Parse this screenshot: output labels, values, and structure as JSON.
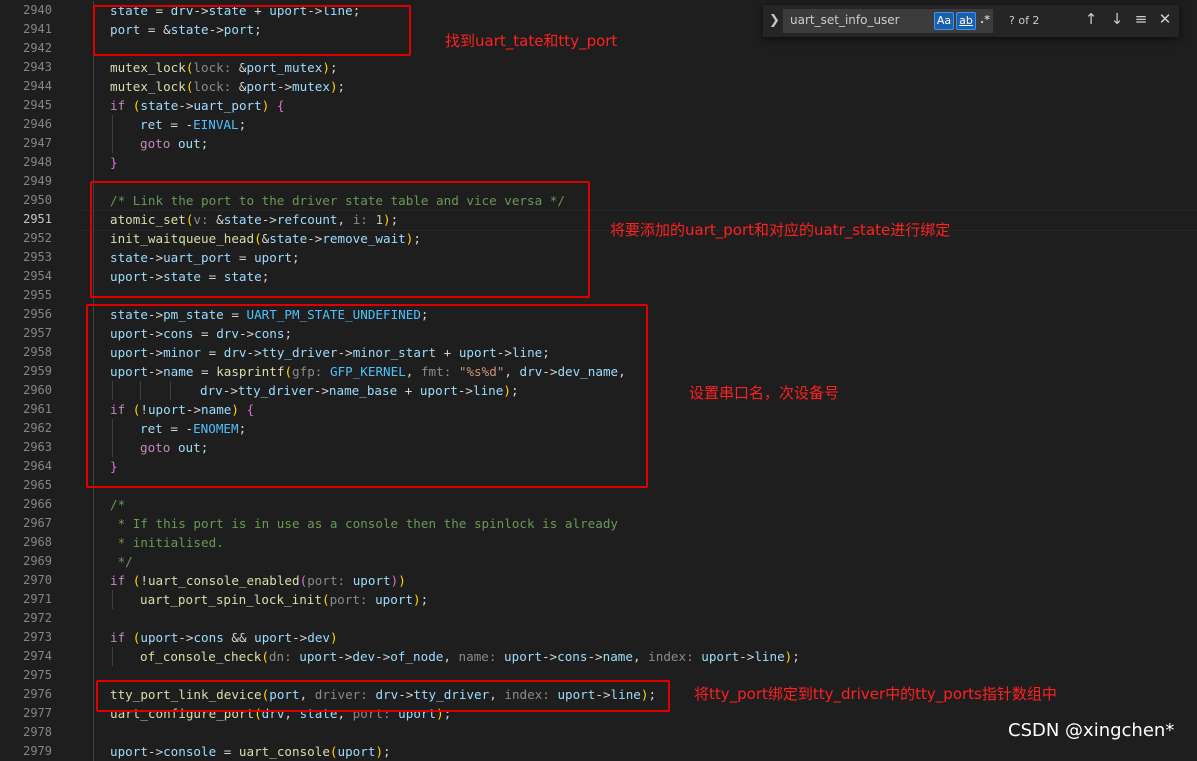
{
  "editor": {
    "current_line": "2951",
    "lines": [
      {
        "n": "2940",
        "ind": 1,
        "t": [
          [
            "var",
            "state"
          ],
          [
            "op",
            " = "
          ],
          [
            "var",
            "drv"
          ],
          [
            "op",
            "->"
          ],
          [
            "var",
            "state"
          ],
          [
            "op",
            " + "
          ],
          [
            "var",
            "uport"
          ],
          [
            "op",
            "->"
          ],
          [
            "var",
            "line"
          ],
          [
            "op",
            ";"
          ]
        ]
      },
      {
        "n": "2941",
        "ind": 1,
        "t": [
          [
            "var",
            "port"
          ],
          [
            "op",
            " = &"
          ],
          [
            "var",
            "state"
          ],
          [
            "op",
            "->"
          ],
          [
            "var",
            "port"
          ],
          [
            "op",
            ";"
          ]
        ]
      },
      {
        "n": "2942",
        "ind": 0,
        "t": []
      },
      {
        "n": "2943",
        "ind": 1,
        "t": [
          [
            "fn",
            "mutex_lock"
          ],
          [
            "br",
            "("
          ],
          [
            "hint",
            "lock: "
          ],
          [
            "op",
            "&"
          ],
          [
            "var",
            "port_mutex"
          ],
          [
            "br",
            ")"
          ],
          [
            "op",
            ";"
          ]
        ]
      },
      {
        "n": "2944",
        "ind": 1,
        "t": [
          [
            "fn",
            "mutex_lock"
          ],
          [
            "br",
            "("
          ],
          [
            "hint",
            "lock: "
          ],
          [
            "op",
            "&"
          ],
          [
            "var",
            "port"
          ],
          [
            "op",
            "->"
          ],
          [
            "var",
            "mutex"
          ],
          [
            "br",
            ")"
          ],
          [
            "op",
            ";"
          ]
        ]
      },
      {
        "n": "2945",
        "ind": 1,
        "t": [
          [
            "kw",
            "if"
          ],
          [
            "op",
            " "
          ],
          [
            "br",
            "("
          ],
          [
            "var",
            "state"
          ],
          [
            "op",
            "->"
          ],
          [
            "var",
            "uart_port"
          ],
          [
            "br",
            ")"
          ],
          [
            "op",
            " "
          ],
          [
            "br2",
            "{"
          ]
        ]
      },
      {
        "n": "2946",
        "ind": 2,
        "t": [
          [
            "var",
            "ret"
          ],
          [
            "op",
            " = -"
          ],
          [
            "const",
            "EINVAL"
          ],
          [
            "op",
            ";"
          ]
        ]
      },
      {
        "n": "2947",
        "ind": 2,
        "t": [
          [
            "kw",
            "goto"
          ],
          [
            "op",
            " "
          ],
          [
            "var",
            "out"
          ],
          [
            "op",
            ";"
          ]
        ]
      },
      {
        "n": "2948",
        "ind": 1,
        "t": [
          [
            "br2",
            "}"
          ]
        ]
      },
      {
        "n": "2949",
        "ind": 0,
        "t": []
      },
      {
        "n": "2950",
        "ind": 1,
        "t": [
          [
            "cmt",
            "/* Link the port to the driver state table and vice versa */"
          ]
        ]
      },
      {
        "n": "2951",
        "ind": 1,
        "t": [
          [
            "fn",
            "atomic_set"
          ],
          [
            "br",
            "("
          ],
          [
            "hint",
            "v: "
          ],
          [
            "op",
            "&"
          ],
          [
            "var",
            "state"
          ],
          [
            "op",
            "->"
          ],
          [
            "var",
            "refcount"
          ],
          [
            "op",
            ", "
          ],
          [
            "hint",
            "i: "
          ],
          [
            "num",
            "1"
          ],
          [
            "br",
            ")"
          ],
          [
            "op",
            ";"
          ]
        ]
      },
      {
        "n": "2952",
        "ind": 1,
        "t": [
          [
            "fn",
            "init_waitqueue_head"
          ],
          [
            "br",
            "("
          ],
          [
            "op",
            "&"
          ],
          [
            "var",
            "state"
          ],
          [
            "op",
            "->"
          ],
          [
            "var",
            "remove_wait"
          ],
          [
            "br",
            ")"
          ],
          [
            "op",
            ";"
          ]
        ]
      },
      {
        "n": "2953",
        "ind": 1,
        "t": [
          [
            "var",
            "state"
          ],
          [
            "op",
            "->"
          ],
          [
            "var",
            "uart_port"
          ],
          [
            "op",
            " = "
          ],
          [
            "var",
            "uport"
          ],
          [
            "op",
            ";"
          ]
        ]
      },
      {
        "n": "2954",
        "ind": 1,
        "t": [
          [
            "var",
            "uport"
          ],
          [
            "op",
            "->"
          ],
          [
            "var",
            "state"
          ],
          [
            "op",
            " = "
          ],
          [
            "var",
            "state"
          ],
          [
            "op",
            ";"
          ]
        ]
      },
      {
        "n": "2955",
        "ind": 0,
        "t": []
      },
      {
        "n": "2956",
        "ind": 1,
        "t": [
          [
            "var",
            "state"
          ],
          [
            "op",
            "->"
          ],
          [
            "var",
            "pm_state"
          ],
          [
            "op",
            " = "
          ],
          [
            "const",
            "UART_PM_STATE_UNDEFINED"
          ],
          [
            "op",
            ";"
          ]
        ]
      },
      {
        "n": "2957",
        "ind": 1,
        "t": [
          [
            "var",
            "uport"
          ],
          [
            "op",
            "->"
          ],
          [
            "var",
            "cons"
          ],
          [
            "op",
            " = "
          ],
          [
            "var",
            "drv"
          ],
          [
            "op",
            "->"
          ],
          [
            "var",
            "cons"
          ],
          [
            "op",
            ";"
          ]
        ]
      },
      {
        "n": "2958",
        "ind": 1,
        "t": [
          [
            "var",
            "uport"
          ],
          [
            "op",
            "->"
          ],
          [
            "var",
            "minor"
          ],
          [
            "op",
            " = "
          ],
          [
            "var",
            "drv"
          ],
          [
            "op",
            "->"
          ],
          [
            "var",
            "tty_driver"
          ],
          [
            "op",
            "->"
          ],
          [
            "var",
            "minor_start"
          ],
          [
            "op",
            " + "
          ],
          [
            "var",
            "uport"
          ],
          [
            "op",
            "->"
          ],
          [
            "var",
            "line"
          ],
          [
            "op",
            ";"
          ]
        ]
      },
      {
        "n": "2959",
        "ind": 1,
        "t": [
          [
            "var",
            "uport"
          ],
          [
            "op",
            "->"
          ],
          [
            "var",
            "name"
          ],
          [
            "op",
            " = "
          ],
          [
            "fn",
            "kasprintf"
          ],
          [
            "br",
            "("
          ],
          [
            "hint",
            "gfp: "
          ],
          [
            "const",
            "GFP_KERNEL"
          ],
          [
            "op",
            ", "
          ],
          [
            "hint",
            "fmt: "
          ],
          [
            "str",
            "\"%s%d\""
          ],
          [
            "op",
            ", "
          ],
          [
            "var",
            "drv"
          ],
          [
            "op",
            "->"
          ],
          [
            "var",
            "dev_name"
          ],
          [
            "op",
            ","
          ]
        ]
      },
      {
        "n": "2960",
        "ind": 3,
        "pad": "          ",
        "t": [
          [
            "var",
            "drv"
          ],
          [
            "op",
            "->"
          ],
          [
            "var",
            "tty_driver"
          ],
          [
            "op",
            "->"
          ],
          [
            "var",
            "name_base"
          ],
          [
            "op",
            " + "
          ],
          [
            "var",
            "uport"
          ],
          [
            "op",
            "->"
          ],
          [
            "var",
            "line"
          ],
          [
            "br",
            ")"
          ],
          [
            "op",
            ";"
          ]
        ]
      },
      {
        "n": "2961",
        "ind": 1,
        "t": [
          [
            "kw",
            "if"
          ],
          [
            "op",
            " "
          ],
          [
            "br",
            "("
          ],
          [
            "op",
            "!"
          ],
          [
            "var",
            "uport"
          ],
          [
            "op",
            "->"
          ],
          [
            "var",
            "name"
          ],
          [
            "br",
            ")"
          ],
          [
            "op",
            " "
          ],
          [
            "br2",
            "{"
          ]
        ]
      },
      {
        "n": "2962",
        "ind": 2,
        "t": [
          [
            "var",
            "ret"
          ],
          [
            "op",
            " = -"
          ],
          [
            "const",
            "ENOMEM"
          ],
          [
            "op",
            ";"
          ]
        ]
      },
      {
        "n": "2963",
        "ind": 2,
        "t": [
          [
            "kw",
            "goto"
          ],
          [
            "op",
            " "
          ],
          [
            "var",
            "out"
          ],
          [
            "op",
            ";"
          ]
        ]
      },
      {
        "n": "2964",
        "ind": 1,
        "t": [
          [
            "br2",
            "}"
          ]
        ]
      },
      {
        "n": "2965",
        "ind": 0,
        "t": []
      },
      {
        "n": "2966",
        "ind": 1,
        "t": [
          [
            "cmt",
            "/*"
          ]
        ]
      },
      {
        "n": "2967",
        "ind": 1,
        "t": [
          [
            "cmt",
            " * If this port is in use as a console then the spinlock is already"
          ]
        ]
      },
      {
        "n": "2968",
        "ind": 1,
        "t": [
          [
            "cmt",
            " * initialised."
          ]
        ]
      },
      {
        "n": "2969",
        "ind": 1,
        "t": [
          [
            "cmt",
            " */"
          ]
        ]
      },
      {
        "n": "2970",
        "ind": 1,
        "t": [
          [
            "kw",
            "if"
          ],
          [
            "op",
            " "
          ],
          [
            "br",
            "("
          ],
          [
            "op",
            "!"
          ],
          [
            "fn",
            "uart_console_enabled"
          ],
          [
            "br2",
            "("
          ],
          [
            "hint",
            "port: "
          ],
          [
            "var",
            "uport"
          ],
          [
            "br2",
            ")"
          ],
          [
            "br",
            ")"
          ]
        ]
      },
      {
        "n": "2971",
        "ind": 2,
        "t": [
          [
            "fn",
            "uart_port_spin_lock_init"
          ],
          [
            "br",
            "("
          ],
          [
            "hint",
            "port: "
          ],
          [
            "var",
            "uport"
          ],
          [
            "br",
            ")"
          ],
          [
            "op",
            ";"
          ]
        ]
      },
      {
        "n": "2972",
        "ind": 0,
        "t": []
      },
      {
        "n": "2973",
        "ind": 1,
        "t": [
          [
            "kw",
            "if"
          ],
          [
            "op",
            " "
          ],
          [
            "br",
            "("
          ],
          [
            "var",
            "uport"
          ],
          [
            "op",
            "->"
          ],
          [
            "var",
            "cons"
          ],
          [
            "op",
            " && "
          ],
          [
            "var",
            "uport"
          ],
          [
            "op",
            "->"
          ],
          [
            "var",
            "dev"
          ],
          [
            "br",
            ")"
          ]
        ]
      },
      {
        "n": "2974",
        "ind": 2,
        "t": [
          [
            "fn",
            "of_console_check"
          ],
          [
            "br",
            "("
          ],
          [
            "hint",
            "dn: "
          ],
          [
            "var",
            "uport"
          ],
          [
            "op",
            "->"
          ],
          [
            "var",
            "dev"
          ],
          [
            "op",
            "->"
          ],
          [
            "var",
            "of_node"
          ],
          [
            "op",
            ", "
          ],
          [
            "hint",
            "name: "
          ],
          [
            "var",
            "uport"
          ],
          [
            "op",
            "->"
          ],
          [
            "var",
            "cons"
          ],
          [
            "op",
            "->"
          ],
          [
            "var",
            "name"
          ],
          [
            "op",
            ", "
          ],
          [
            "hint",
            "index: "
          ],
          [
            "var",
            "uport"
          ],
          [
            "op",
            "->"
          ],
          [
            "var",
            "line"
          ],
          [
            "br",
            ")"
          ],
          [
            "op",
            ";"
          ]
        ]
      },
      {
        "n": "2975",
        "ind": 0,
        "t": []
      },
      {
        "n": "2976",
        "ind": 1,
        "t": [
          [
            "fn",
            "tty_port_link_device"
          ],
          [
            "br",
            "("
          ],
          [
            "var",
            "port"
          ],
          [
            "op",
            ", "
          ],
          [
            "hint",
            "driver: "
          ],
          [
            "var",
            "drv"
          ],
          [
            "op",
            "->"
          ],
          [
            "var",
            "tty_driver"
          ],
          [
            "op",
            ", "
          ],
          [
            "hint",
            "index: "
          ],
          [
            "var",
            "uport"
          ],
          [
            "op",
            "->"
          ],
          [
            "var",
            "line"
          ],
          [
            "br",
            ")"
          ],
          [
            "op",
            ";"
          ]
        ]
      },
      {
        "n": "2977",
        "ind": 1,
        "t": [
          [
            "fn",
            "uart_configure_port"
          ],
          [
            "br",
            "("
          ],
          [
            "var",
            "drv"
          ],
          [
            "op",
            ", "
          ],
          [
            "var",
            "state"
          ],
          [
            "op",
            ", "
          ],
          [
            "hint",
            "port: "
          ],
          [
            "var",
            "uport"
          ],
          [
            "br",
            ")"
          ],
          [
            "op",
            ";"
          ]
        ]
      },
      {
        "n": "2978",
        "ind": 0,
        "t": []
      },
      {
        "n": "2979",
        "ind": 1,
        "t": [
          [
            "var",
            "uport"
          ],
          [
            "op",
            "->"
          ],
          [
            "var",
            "console"
          ],
          [
            "op",
            " = "
          ],
          [
            "fn",
            "uart_console"
          ],
          [
            "br",
            "("
          ],
          [
            "var",
            "uport"
          ],
          [
            "br",
            ")"
          ],
          [
            "op",
            ";"
          ]
        ]
      }
    ]
  },
  "annotations": [
    {
      "text": "找到uart_tate和tty_port"
    },
    {
      "text": "将要添加的uart_port和对应的uatr_state进行绑定"
    },
    {
      "text": "设置串口名，次设备号"
    },
    {
      "text": "将tty_port绑定到tty_driver中的tty_ports指针数组中"
    }
  ],
  "find_widget": {
    "value": "uart_set_info_user",
    "match_case": "Aa",
    "whole_word": "ab",
    "regex": ".*",
    "count": "? of 2"
  },
  "watermark": "CSDN @xingchen*",
  "colors": {
    "annotation": "#e00000",
    "background": "#1e1e1e"
  }
}
